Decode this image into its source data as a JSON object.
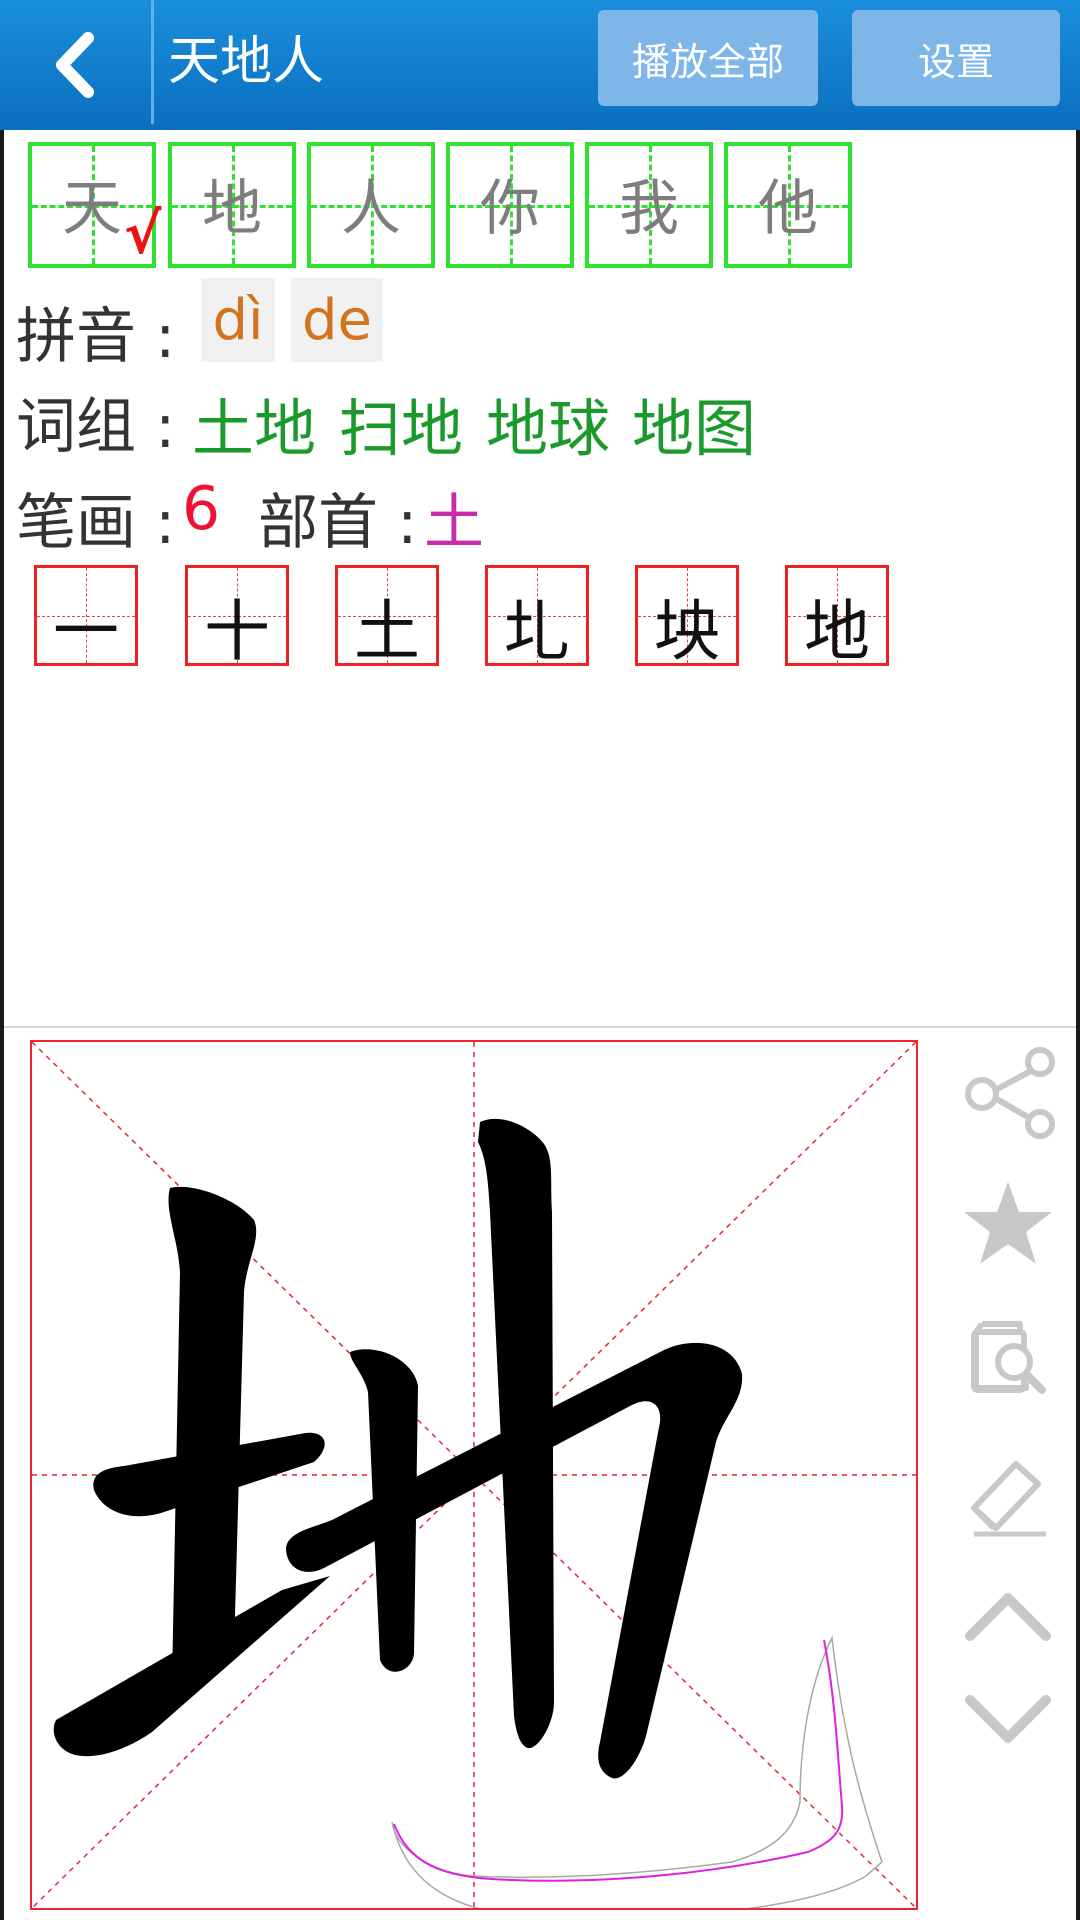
{
  "header": {
    "title": "天地人",
    "play_all_label": "播放全部",
    "settings_label": "设置"
  },
  "char_tabs": [
    "天",
    "地",
    "人",
    "你",
    "我",
    "他"
  ],
  "check_mark": "√",
  "pinyin": {
    "label": "拼音 :",
    "readings": [
      "dì",
      "de"
    ]
  },
  "words": {
    "label": "词组 :",
    "items": [
      "土地",
      "扫地",
      "地球",
      "地图"
    ]
  },
  "strokes": {
    "label": "笔画 :",
    "count": "6",
    "radical_label": "部首 :",
    "radical": "土"
  },
  "stroke_order": [
    "一",
    "十",
    "土",
    "圠",
    "坱",
    "地"
  ],
  "pad": {
    "character": "地"
  },
  "side_icons": [
    "share-icon",
    "star-icon",
    "search-document-icon",
    "eraser-icon",
    "chevron-up-icon",
    "chevron-down-icon"
  ],
  "colors": {
    "header": "#1a85d6",
    "tab_border": "#2fe22f",
    "pinyin": "#d2741d",
    "words": "#1a9a2a",
    "stroke_count": "#ee1133",
    "radical": "#c82aa8",
    "grid": "#ee2233"
  }
}
